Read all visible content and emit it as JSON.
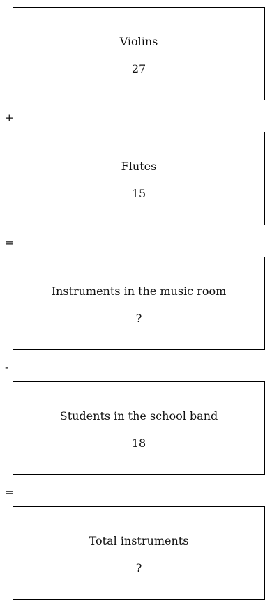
{
  "boxes": [
    {
      "label": "Violins",
      "value": "27"
    },
    {
      "label": "Flutes",
      "value": "15"
    },
    {
      "label": "Instruments in the music room",
      "value": "?"
    },
    {
      "label": "Students in the school band",
      "value": "18"
    },
    {
      "label": "Total instruments",
      "value": "?"
    }
  ],
  "operators": [
    "+",
    "=",
    "-",
    "="
  ]
}
